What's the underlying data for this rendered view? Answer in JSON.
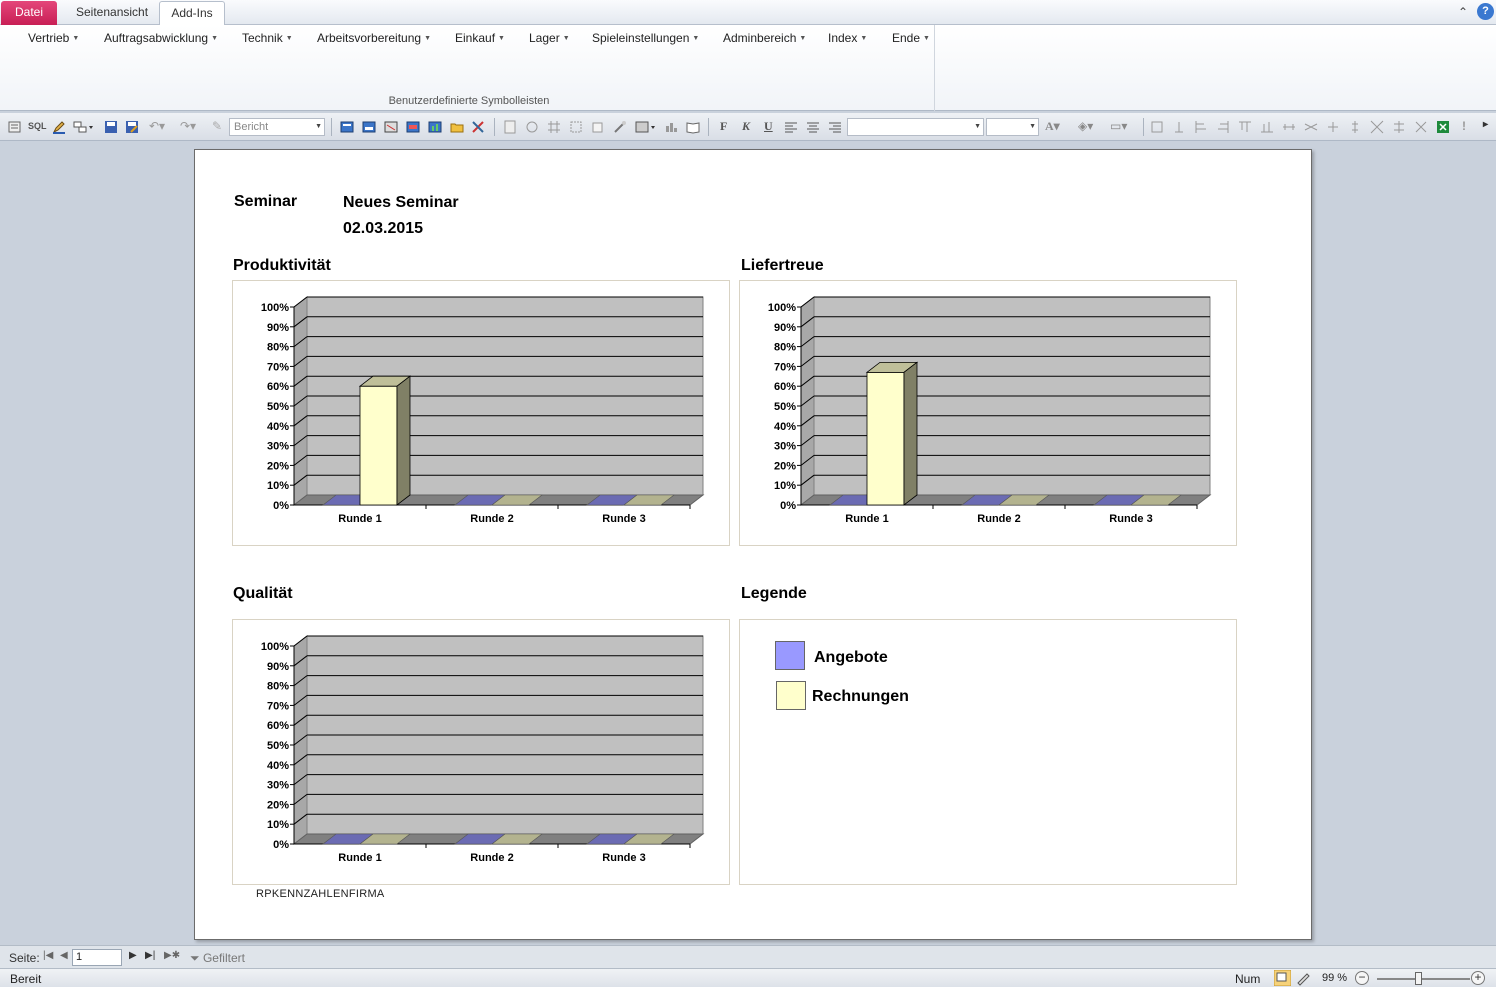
{
  "tabs": [
    "Datei",
    "Seitenansicht",
    "Add-Ins"
  ],
  "ribbon": {
    "menus": [
      "Vertrieb",
      "Auftragsabwicklung",
      "Technik",
      "Arbeitsvorbereitung",
      "Einkauf",
      "Lager",
      "Spieleinstellungen",
      "Adminbereich",
      "Index",
      "Ende"
    ],
    "group_label": "Benutzerdefinierte Symbolleisten"
  },
  "toolbar": {
    "object_combo": "Bericht",
    "font_combo": "",
    "size_combo": "",
    "bold": "F",
    "italic": "K",
    "underline": "U",
    "sql": "SQL"
  },
  "report": {
    "seminar_label": "Seminar",
    "seminar_name": "Neues Seminar",
    "seminar_date": "02.03.2015",
    "footer": "RPKENNZAHLENFIRMA",
    "legend_title": "Legende",
    "legend": [
      {
        "label": "Angebote",
        "color": "#9999ff"
      },
      {
        "label": "Rechnungen",
        "color": "#ffffcc"
      }
    ]
  },
  "chart_data": [
    {
      "type": "bar",
      "title": "Produktivität",
      "categories": [
        "Runde 1",
        "Runde 2",
        "Runde 3"
      ],
      "series": [
        {
          "name": "Angebote",
          "values": [
            0,
            0,
            0
          ],
          "color": "#9999ff"
        },
        {
          "name": "Rechnungen",
          "values": [
            60,
            0,
            0
          ],
          "color": "#ffffcc"
        }
      ],
      "ylim": [
        0,
        100
      ],
      "yticks": [
        "0%",
        "10%",
        "20%",
        "30%",
        "40%",
        "50%",
        "60%",
        "70%",
        "80%",
        "90%",
        "100%"
      ],
      "grid": true
    },
    {
      "type": "bar",
      "title": "Liefertreue",
      "categories": [
        "Runde 1",
        "Runde 2",
        "Runde 3"
      ],
      "series": [
        {
          "name": "Angebote",
          "values": [
            0,
            0,
            0
          ],
          "color": "#9999ff"
        },
        {
          "name": "Rechnungen",
          "values": [
            67,
            0,
            0
          ],
          "color": "#ffffcc"
        }
      ],
      "ylim": [
        0,
        100
      ],
      "yticks": [
        "0%",
        "10%",
        "20%",
        "30%",
        "40%",
        "50%",
        "60%",
        "70%",
        "80%",
        "90%",
        "100%"
      ],
      "grid": true
    },
    {
      "type": "bar",
      "title": "Qualität",
      "categories": [
        "Runde 1",
        "Runde 2",
        "Runde 3"
      ],
      "series": [
        {
          "name": "Angebote",
          "values": [
            0,
            0,
            0
          ],
          "color": "#9999ff"
        },
        {
          "name": "Rechnungen",
          "values": [
            0,
            0,
            0
          ],
          "color": "#ffffcc"
        }
      ],
      "ylim": [
        0,
        100
      ],
      "yticks": [
        "0%",
        "10%",
        "20%",
        "30%",
        "40%",
        "50%",
        "60%",
        "70%",
        "80%",
        "90%",
        "100%"
      ],
      "grid": true
    }
  ],
  "navigation": {
    "page_label": "Seite:",
    "page_value": "1",
    "filter_label": "Gefiltert"
  },
  "status": {
    "text": "Bereit",
    "num": "Num",
    "zoom": "99 %"
  }
}
